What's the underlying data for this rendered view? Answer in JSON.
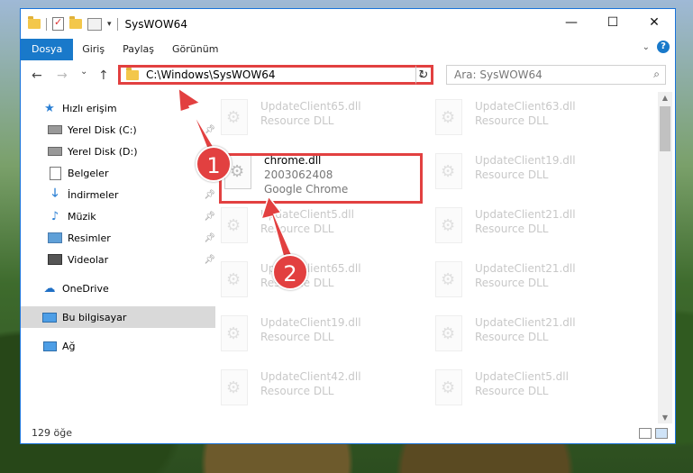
{
  "window": {
    "title": "SysWOW64",
    "controls": {
      "minimize": "—",
      "maximize": "☐",
      "close": "✕"
    }
  },
  "ribbon": {
    "tabs": [
      "Dosya",
      "Giriş",
      "Paylaş",
      "Görünüm"
    ],
    "collapse_icon": "chevron-down-icon",
    "help": "?"
  },
  "nav": {
    "back": "←",
    "forward": "→",
    "recent": "⌄",
    "up": "↑",
    "address": "C:\\Windows\\SysWOW64",
    "refresh": "↻",
    "search_placeholder": "Ara: SysWOW64"
  },
  "sidebar": {
    "items": [
      {
        "label": "Hızlı erişim",
        "icon": "star-icon",
        "pinned": false
      },
      {
        "label": "Yerel Disk (C:)",
        "icon": "drive-icon",
        "pinned": true
      },
      {
        "label": "Yerel Disk (D:)",
        "icon": "drive-icon",
        "pinned": true
      },
      {
        "label": "Belgeler",
        "icon": "documents-icon",
        "pinned": true
      },
      {
        "label": "İndirmeler",
        "icon": "download-icon",
        "pinned": true
      },
      {
        "label": "Müzik",
        "icon": "music-icon",
        "pinned": true
      },
      {
        "label": "Resimler",
        "icon": "pictures-icon",
        "pinned": true
      },
      {
        "label": "Videolar",
        "icon": "videos-icon",
        "pinned": true
      },
      {
        "label": "OneDrive",
        "icon": "cloud-icon",
        "pinned": false
      },
      {
        "label": "Bu bilgisayar",
        "icon": "computer-icon",
        "pinned": false
      },
      {
        "label": "Ağ",
        "icon": "network-icon",
        "pinned": false
      }
    ]
  },
  "files": [
    {
      "name": "UpdateClient65.dll",
      "desc": "Resource DLL",
      "faded": true
    },
    {
      "name": "UpdateClient63.dll",
      "desc": "Resource DLL",
      "faded": true
    },
    {
      "name": "chrome.dll",
      "desc": "2003062408",
      "desc2": "Google Chrome",
      "faded": false
    },
    {
      "name": "UpdateClient19.dll",
      "desc": "Resource DLL",
      "faded": true
    },
    {
      "name": "UpdateClient5.dll",
      "desc": "Resource DLL",
      "faded": true
    },
    {
      "name": "UpdateClient21.dll",
      "desc": "Resource DLL",
      "faded": true
    },
    {
      "name": "UpdateClient65.dll",
      "desc": "Resource DLL",
      "faded": true
    },
    {
      "name": "UpdateClient21.dll",
      "desc": "Resource DLL",
      "faded": true
    },
    {
      "name": "UpdateClient19.dll",
      "desc": "Resource DLL",
      "faded": true
    },
    {
      "name": "UpdateClient21.dll",
      "desc": "Resource DLL",
      "faded": true
    },
    {
      "name": "UpdateClient42.dll",
      "desc": "Resource DLL",
      "faded": true
    },
    {
      "name": "UpdateClient5.dll",
      "desc": "Resource DLL",
      "faded": true
    }
  ],
  "status": {
    "count": "129 öğe"
  },
  "callouts": [
    "1",
    "2"
  ],
  "colors": {
    "accent": "#1979ca",
    "highlight": "#e24040"
  }
}
